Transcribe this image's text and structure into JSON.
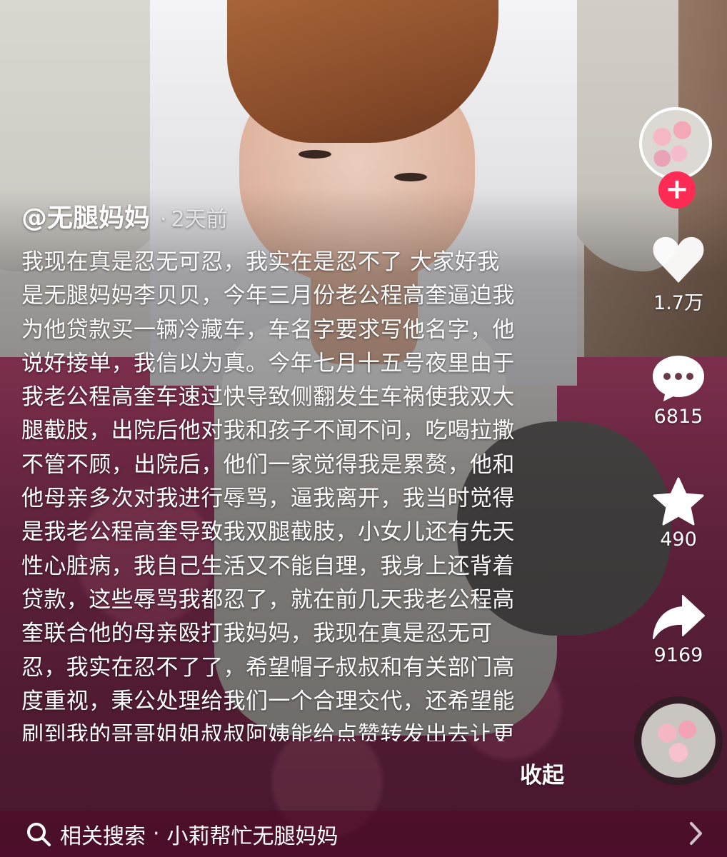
{
  "post": {
    "author": "@无腿妈妈",
    "separator": "·",
    "time": "2天前",
    "caption_lines": [
      "我现在真是忍无可忍，我实在是忍不了 大家好我",
      "是无腿妈妈李贝贝，今年三月份老公程高奎逼迫我",
      "为他贷款买一辆冷藏车，车名字要求写他名字，他",
      "说好接单，我信以为真。今年七月十五号夜里由于",
      "我老公程高奎车速过快导致侧翻发生车祸使我双大",
      "腿截肢，出院后他对我和孩子不闻不问，吃喝拉撒",
      "不管不顾，出院后，他们一家觉得我是累赘，他和",
      "他母亲多次对我进行辱骂，逼我离开，我当时觉得",
      "是我老公程高奎导致我双腿截肢，小女儿还有先天",
      "性心脏病，我自己生活又不能自理，我身上还背着",
      "贷款，这些辱骂我都忍了，就在前几天我老公程高",
      "奎联合他的母亲殴打我妈妈，我现在真是忍无可",
      "忍，我实在忍不了了，希望帽子叔叔和有关部门高",
      "度重视，秉公处理给我们一个合理交代，还希望能",
      "刷到我的哥哥姐姐叔叔阿姨能给点赞转发出去让更"
    ],
    "collapse_label": "收起"
  },
  "actions": {
    "follow_symbol": "+",
    "likes": "1.7万",
    "comments": "6815",
    "favorites": "490",
    "shares": "9169"
  },
  "related_search": {
    "label": "相关搜索",
    "separator": "·",
    "query": "小莉帮忙无腿妈妈"
  },
  "icons": {
    "like": "heart-icon",
    "comment": "comment-bubble-icon",
    "favorite": "star-icon",
    "share": "share-arrow-icon",
    "search": "search-icon",
    "chevron": "chevron-right-icon"
  },
  "colors": {
    "follow": "#fe2c55",
    "text": "#ffffff"
  }
}
